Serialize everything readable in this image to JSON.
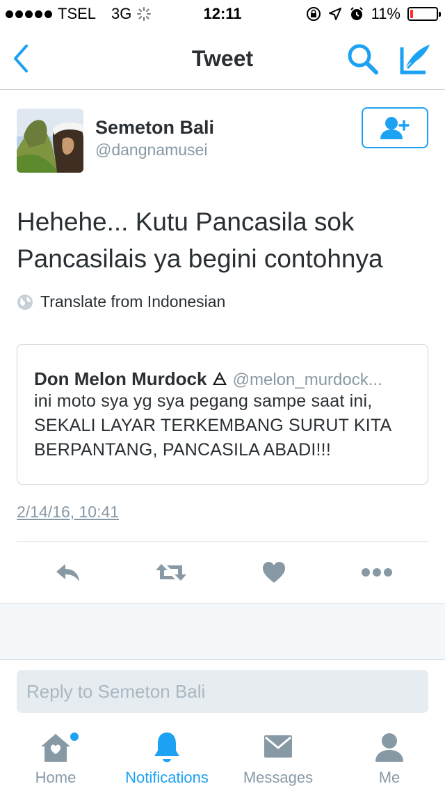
{
  "status_bar": {
    "carrier": "TSEL",
    "network": "3G",
    "time": "12:11",
    "battery": "11%",
    "battery_level": 0.11
  },
  "nav": {
    "title": "Tweet",
    "back_icon": "chevron-left-icon",
    "search_icon": "search-icon",
    "compose_icon": "compose-icon"
  },
  "tweet": {
    "author_name": "Semeton Bali",
    "author_handle": "@dangnamusei",
    "text": "Hehehe... Kutu Pancasila sok Pancasilais ya begini contohnya",
    "translate_label": "Translate from Indonesian",
    "timestamp": "2/14/16, 10:41"
  },
  "quote": {
    "name": "Don Melon Murdock",
    "symbol": "🜁",
    "handle": "@melon_murdock...",
    "text": "ini moto sya yg sya pegang sampe saat ini, SEKALI LAYAR TERKEMBANG SURUT KITA BERPANTANG, PANCASILA ABADI!!!"
  },
  "actions": [
    "reply-icon",
    "retweet-icon",
    "like-icon",
    "more-icon"
  ],
  "reply": {
    "placeholder": "Reply to Semeton Bali"
  },
  "tabs": [
    {
      "label": "Home",
      "icon": "home-icon"
    },
    {
      "label": "Notifications",
      "icon": "bell-icon"
    },
    {
      "label": "Messages",
      "icon": "envelope-icon"
    },
    {
      "label": "Me",
      "icon": "person-icon"
    }
  ],
  "colors": {
    "accent": "#1da1f2",
    "icon_gray": "#8899a6",
    "battery_low": "#ff2d2d"
  }
}
